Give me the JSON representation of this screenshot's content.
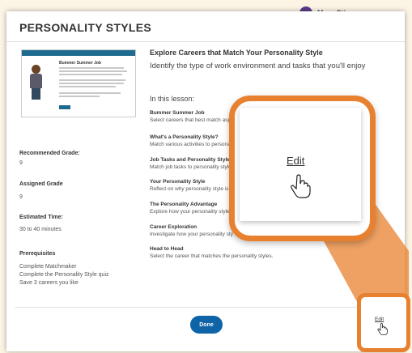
{
  "background": {
    "user_name": "Marc Sti..."
  },
  "modal": {
    "title": "PERSONALITY STYLES",
    "thumbnail": {
      "heading": "Bummer Summer Job"
    },
    "recommended_grade_label": "Recommended Grade:",
    "recommended_grade_value": "9",
    "assigned_grade_label": "Assigned Grade",
    "assigned_grade_value": "9",
    "estimated_time_label": "Estimated Time:",
    "estimated_time_value": "30 to 40 minutes",
    "prerequisites_label": "Prerequisites",
    "prerequisites": [
      "Complete Matchmaker",
      "Complete the Personality Style quiz",
      "Save 3 careers you like"
    ],
    "lesson_title": "Explore Careers that Match Your Personality Style",
    "lesson_subtitle": "Identify the type of work environment and tasks that you'll enjoy",
    "in_this_lesson": "In this lesson:",
    "items": [
      {
        "title": "Bummer Summer Job",
        "desc": "Select careers that best match aspects of a teen job-seeker's personality style."
      },
      {
        "title": "What's a Personality Style?",
        "desc": "Match various activities to personality"
      },
      {
        "title": "Job Tasks and Personality Style",
        "desc": "Match job tasks to personality style"
      },
      {
        "title": "Your Personality Style",
        "desc": "Reflect on why personality style is i"
      },
      {
        "title": "The Personality Advantage",
        "desc": "Explore how your personality style"
      },
      {
        "title": "Career Exploration",
        "desc": "Investigate how your personality sty"
      },
      {
        "title": "Head to Head",
        "desc": "Select the career that matches the personality styles."
      }
    ],
    "done_label": "Done"
  },
  "zoom": {
    "edit_label": "Edit"
  },
  "corner": {
    "edit_label": "Edit"
  },
  "colors": {
    "accent": "#e8812f",
    "primary": "#0f63a7"
  }
}
